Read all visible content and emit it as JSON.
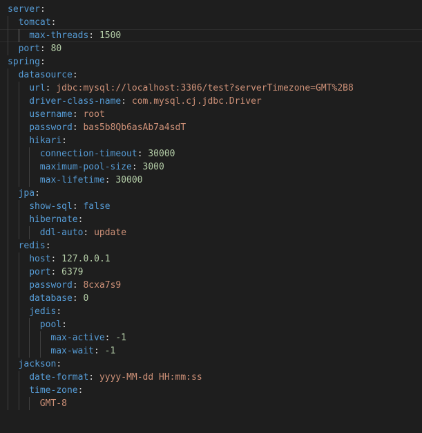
{
  "editor": {
    "language": "yaml",
    "theme_colors": {
      "background": "#1e1e1e",
      "key": "#569cd6",
      "string": "#ce9178",
      "number": "#b5cea8",
      "boolean": "#569cd6",
      "punctuation": "#d4d4d4",
      "indent_guide": "#404040"
    },
    "lines": [
      {
        "indent": 0,
        "key": "server",
        "value": "",
        "type": ""
      },
      {
        "indent": 1,
        "key": "tomcat",
        "value": "",
        "type": ""
      },
      {
        "indent": 2,
        "key": "max-threads",
        "value": "1500",
        "type": "number",
        "current": true
      },
      {
        "indent": 1,
        "key": "port",
        "value": "80",
        "type": "number"
      },
      {
        "indent": 0,
        "key": "spring",
        "value": "",
        "type": ""
      },
      {
        "indent": 1,
        "key": "datasource",
        "value": "",
        "type": ""
      },
      {
        "indent": 2,
        "key": "url",
        "value": "jdbc:mysql://localhost:3306/test?serverTimezone=GMT%2B8",
        "type": "string"
      },
      {
        "indent": 2,
        "key": "driver-class-name",
        "value": "com.mysql.cj.jdbc.Driver",
        "type": "string"
      },
      {
        "indent": 2,
        "key": "username",
        "value": "root",
        "type": "string"
      },
      {
        "indent": 2,
        "key": "password",
        "value": "bas5b8Qb6asAb7a4sdT",
        "type": "string"
      },
      {
        "indent": 2,
        "key": "hikari",
        "value": "",
        "type": ""
      },
      {
        "indent": 3,
        "key": "connection-timeout",
        "value": "30000",
        "type": "number"
      },
      {
        "indent": 3,
        "key": "maximum-pool-size",
        "value": "3000",
        "type": "number"
      },
      {
        "indent": 3,
        "key": "max-lifetime",
        "value": "30000",
        "type": "number"
      },
      {
        "indent": 1,
        "key": "jpa",
        "value": "",
        "type": ""
      },
      {
        "indent": 2,
        "key": "show-sql",
        "value": "false",
        "type": "boolean"
      },
      {
        "indent": 2,
        "key": "hibernate",
        "value": "",
        "type": ""
      },
      {
        "indent": 3,
        "key": "ddl-auto",
        "value": "update",
        "type": "string"
      },
      {
        "indent": 1,
        "key": "redis",
        "value": "",
        "type": ""
      },
      {
        "indent": 2,
        "key": "host",
        "value": "127.0.0.1",
        "type": "number"
      },
      {
        "indent": 2,
        "key": "port",
        "value": "6379",
        "type": "number"
      },
      {
        "indent": 2,
        "key": "password",
        "value": "8cxa7s9",
        "type": "string"
      },
      {
        "indent": 2,
        "key": "database",
        "value": "0",
        "type": "number"
      },
      {
        "indent": 2,
        "key": "jedis",
        "value": "",
        "type": ""
      },
      {
        "indent": 3,
        "key": "pool",
        "value": "",
        "type": ""
      },
      {
        "indent": 4,
        "key": "max-active",
        "value": "-1",
        "type": "number"
      },
      {
        "indent": 4,
        "key": "max-wait",
        "value": "-1",
        "type": "number"
      },
      {
        "indent": 1,
        "key": "jackson",
        "value": "",
        "type": ""
      },
      {
        "indent": 2,
        "key": "date-format",
        "value": "yyyy-MM-dd HH:mm:ss",
        "type": "string"
      },
      {
        "indent": 2,
        "key": "time-zone",
        "value": "",
        "type": ""
      },
      {
        "indent": 3,
        "key": "",
        "value": "GMT-8",
        "type": "string"
      }
    ]
  }
}
